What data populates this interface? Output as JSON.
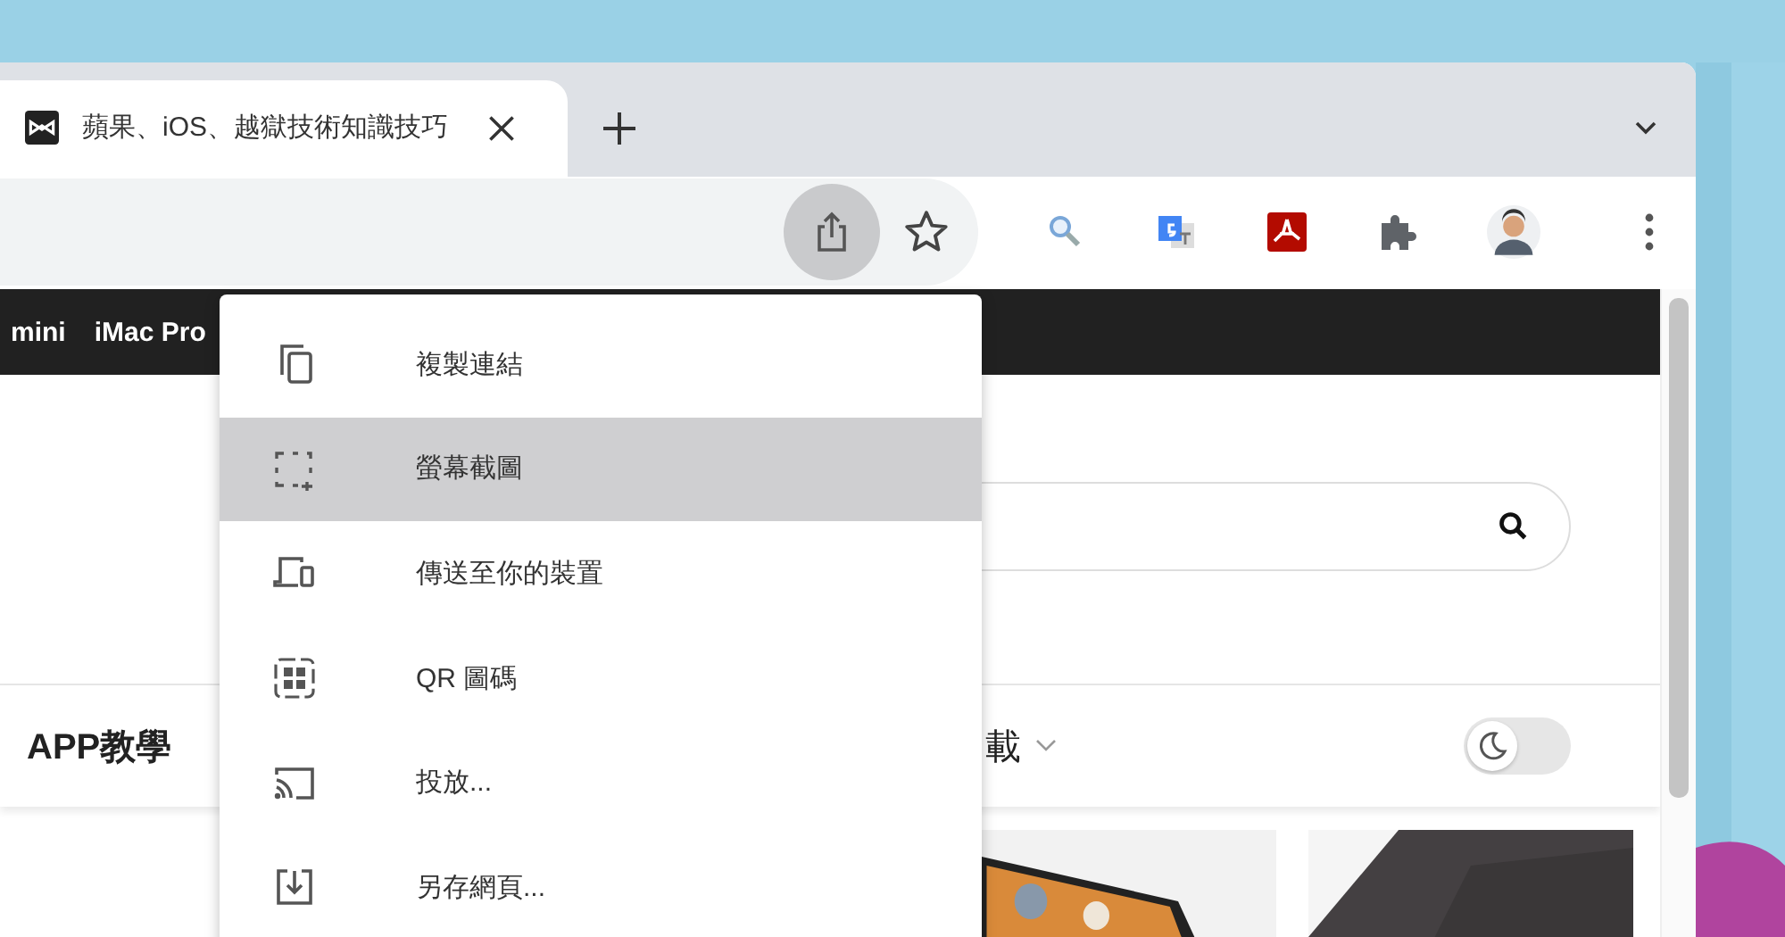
{
  "tabs": [
    {
      "title": "蘋果、iOS、越獄技術知識技巧",
      "selected": true
    }
  ],
  "toolbar": {
    "share_pressed": true
  },
  "site_nav": [
    "mini",
    "iMac Pro"
  ],
  "categories": [
    {
      "label": "APP教學",
      "dropdown": false
    },
    {
      "label": "載",
      "dropdown": true
    }
  ],
  "dark_mode_toggle": {
    "on": false
  },
  "share_menu": [
    {
      "label": "複製連結",
      "kind": "copy",
      "selected": false
    },
    {
      "label": "螢幕截圖",
      "kind": "screenshot",
      "selected": true
    },
    {
      "label": "傳送至你的裝置",
      "kind": "devices",
      "selected": false
    },
    {
      "label": "QR 圖碼",
      "kind": "qr",
      "selected": false
    },
    {
      "label": "投放...",
      "kind": "cast",
      "selected": false
    },
    {
      "label": "另存網頁...",
      "kind": "save",
      "selected": false
    }
  ]
}
